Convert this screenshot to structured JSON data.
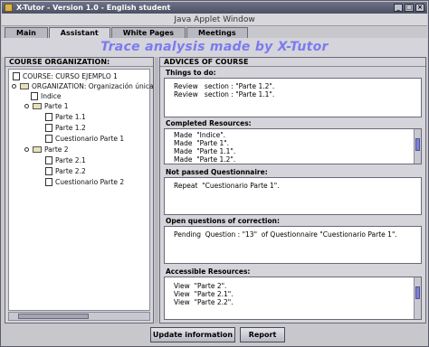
{
  "window": {
    "title": "X-Tutor - Version 1.0 - English   student",
    "applet_label": "Java Applet Window"
  },
  "tabs": [
    {
      "label": "Main"
    },
    {
      "label": "Assistant"
    },
    {
      "label": "White Pages"
    },
    {
      "label": "Meetings"
    }
  ],
  "banner": "Trace analysis made by X-Tutor",
  "course_organization": {
    "title": "COURSE ORGANIZATION:",
    "tree": [
      {
        "label": "COURSE: CURSO EJEMPLO 1"
      },
      {
        "label": "ORGANIZATION: Organización única"
      },
      {
        "label": "Indice"
      },
      {
        "label": "Parte 1"
      },
      {
        "label": "Parte 1.1"
      },
      {
        "label": "Parte 1.2"
      },
      {
        "label": "Cuestionario Parte 1"
      },
      {
        "label": "Parte 2"
      },
      {
        "label": "Parte 2.1"
      },
      {
        "label": "Parte 2.2"
      },
      {
        "label": "Cuestionario Parte 2"
      }
    ]
  },
  "advices": {
    "title": "ADVICES OF COURSE",
    "things_to_do": {
      "title": "Things to do:",
      "lines": [
        "Review   section : \"Parte 1.2\".",
        "Review   section : \"Parte 1.1\"."
      ]
    },
    "completed_resources": {
      "title": "Completed Resources:",
      "lines": [
        "Made  \"Indice\".",
        "Made  \"Parte 1\".",
        "Made  \"Parte 1.1\".",
        "Made  \"Parte 1.2\"."
      ]
    },
    "not_passed": {
      "title": "Not passed Questionnaire:",
      "lines": [
        "Repeat  \"Cuestionario Parte 1\"."
      ]
    },
    "open_questions": {
      "title": "Open questions of correction:",
      "lines": [
        "Pending  Question : \"13\"  of Questionnaire \"Cuestionario Parte 1\"."
      ]
    },
    "accessible_resources": {
      "title": "Accessible Resources:",
      "lines": [
        "View  \"Parte 2\".",
        "View  \"Parte 2.1\".",
        "View  \"Parte 2.2\"."
      ]
    }
  },
  "buttons": {
    "update": "Update information",
    "report": "Report"
  }
}
